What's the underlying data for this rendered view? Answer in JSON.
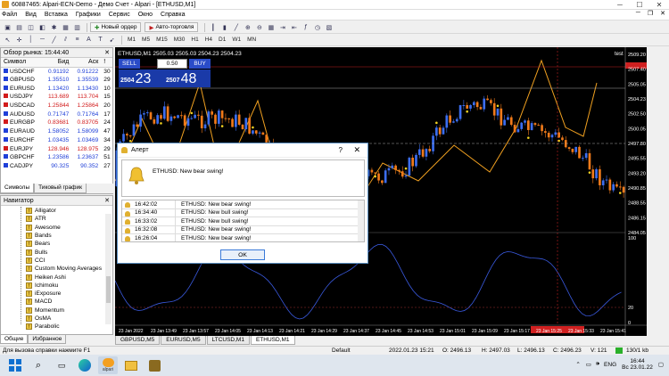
{
  "window": {
    "title": "60887465: Alpari-ECN-Demo - Демо Счет - Alpari - [ETHUSD,M1]"
  },
  "menu": {
    "items": [
      "Файл",
      "Вид",
      "Вставка",
      "Графики",
      "Сервис",
      "Окно",
      "Справка"
    ]
  },
  "toolbar": {
    "new_order": "Новый ордер",
    "auto_trading": "Авто-торговля",
    "timeframes": [
      "M1",
      "M5",
      "M15",
      "M30",
      "H1",
      "H4",
      "D1",
      "W1",
      "MN"
    ]
  },
  "market_watch": {
    "title": "Обзор рынка: 15:44:40",
    "columns": [
      "Символ",
      "Бид",
      "Аск",
      "!"
    ],
    "rows": [
      {
        "symbol": "USDCHF",
        "bid": "0.91192",
        "ask": "0.91222",
        "spread": "30",
        "dir": "up"
      },
      {
        "symbol": "GBPUSD",
        "bid": "1.35510",
        "ask": "1.35539",
        "spread": "29",
        "dir": "up"
      },
      {
        "symbol": "EURUSD",
        "bid": "1.13420",
        "ask": "1.13430",
        "spread": "10",
        "dir": "up"
      },
      {
        "symbol": "USDJPY",
        "bid": "113.689",
        "ask": "113.704",
        "spread": "15",
        "dir": "dn"
      },
      {
        "symbol": "USDCAD",
        "bid": "1.25844",
        "ask": "1.25864",
        "spread": "20",
        "dir": "dn"
      },
      {
        "symbol": "AUDUSD",
        "bid": "0.71747",
        "ask": "0.71764",
        "spread": "17",
        "dir": "up"
      },
      {
        "symbol": "EURGBP",
        "bid": "0.83681",
        "ask": "0.83705",
        "spread": "24",
        "dir": "dn"
      },
      {
        "symbol": "EURAUD",
        "bid": "1.58052",
        "ask": "1.58099",
        "spread": "47",
        "dir": "up"
      },
      {
        "symbol": "EURCHF",
        "bid": "1.03435",
        "ask": "1.03469",
        "spread": "34",
        "dir": "up"
      },
      {
        "symbol": "EURJPY",
        "bid": "128.946",
        "ask": "128.975",
        "spread": "29",
        "dir": "dn"
      },
      {
        "symbol": "GBPCHF",
        "bid": "1.23586",
        "ask": "1.23637",
        "spread": "51",
        "dir": "up"
      },
      {
        "symbol": "CADJPY",
        "bid": "90.325",
        "ask": "90.352",
        "spread": "27",
        "dir": "up"
      }
    ],
    "tabs": [
      "Символы",
      "Тиковый график"
    ]
  },
  "navigator": {
    "title": "Навигатор",
    "items": [
      "Alligator",
      "ATR",
      "Awesome",
      "Bands",
      "Bears",
      "Bulls",
      "CCI",
      "Custom Moving Averages",
      "Heiken Ashi",
      "Ichimoku",
      "iExposure",
      "MACD",
      "Momentum",
      "OsMA",
      "Parabolic"
    ],
    "tabs": [
      "Общие",
      "Избранное"
    ]
  },
  "chart": {
    "symbol_label": "ETHUSD,M1",
    "ohlc": "2505.03 2505.03 2504.23 2504.23",
    "corner_label": "test",
    "price_labels": [
      "2509.20",
      "2507.40",
      "2505.05",
      "2504.23",
      "2502.50",
      "2500.05",
      "2497.80",
      "2495.55",
      "2493.20",
      "2490.85",
      "2488.55",
      "2486.15",
      "2484.05"
    ],
    "osc_labels": [
      "100",
      "20",
      "0"
    ],
    "time_labels": [
      "23 Jan 2022",
      "23 Jan 13:49",
      "23 Jan 13:57",
      "23 Jan 14:05",
      "23 Jan 14:13",
      "23 Jan 14:21",
      "23 Jan 14:29",
      "23 Jan 14:37",
      "23 Jan 14:45",
      "23 Jan 14:53",
      "23 Jan 15:01",
      "23 Jan 15:09",
      "23 Jan 15:17",
      "23 Jan 15:25",
      "23 Jan 15:33",
      "23 Jan 15:41"
    ],
    "red_time_label": "2022.01.23 15:21"
  },
  "one_click": {
    "sell": "SELL",
    "buy": "BUY",
    "lot": "0.50",
    "sell_small": "2504",
    "sell_big": "23",
    "buy_small": "2507",
    "buy_big": "48"
  },
  "chart_tabs": [
    "GBPUSD,M5",
    "EURUSD,M5",
    "LTCUSD,M1",
    "ETHUSD,M1"
  ],
  "status": {
    "help": "Для вызова справки нажмите F1",
    "profile": "Default",
    "datetime": "2022.01.23 15:21",
    "open": "O: 2496.13",
    "high": "H: 2497.03",
    "low": "L: 2496.13",
    "close": "C: 2496.23",
    "volume": "V: 121",
    "traffic": "130/1 kb"
  },
  "dialog": {
    "title": "Алерт",
    "help": "?",
    "close": "✕",
    "message": "ETHUSD: New bear swing!",
    "log": [
      {
        "time": "16:42:02",
        "msg": "ETHUSD: New bear swing!"
      },
      {
        "time": "16:34:40",
        "msg": "ETHUSD: New bull swing!"
      },
      {
        "time": "16:33:02",
        "msg": "ETHUSD: New bull swing!"
      },
      {
        "time": "16:32:08",
        "msg": "ETHUSD: New bear swing!"
      },
      {
        "time": "16:26:04",
        "msg": "ETHUSD: New bear swing!"
      }
    ],
    "ok": "OK"
  },
  "taskbar": {
    "lang": "ENG",
    "time": "16:44",
    "date": "Вс 23.01.22",
    "app_label": "alpari"
  }
}
